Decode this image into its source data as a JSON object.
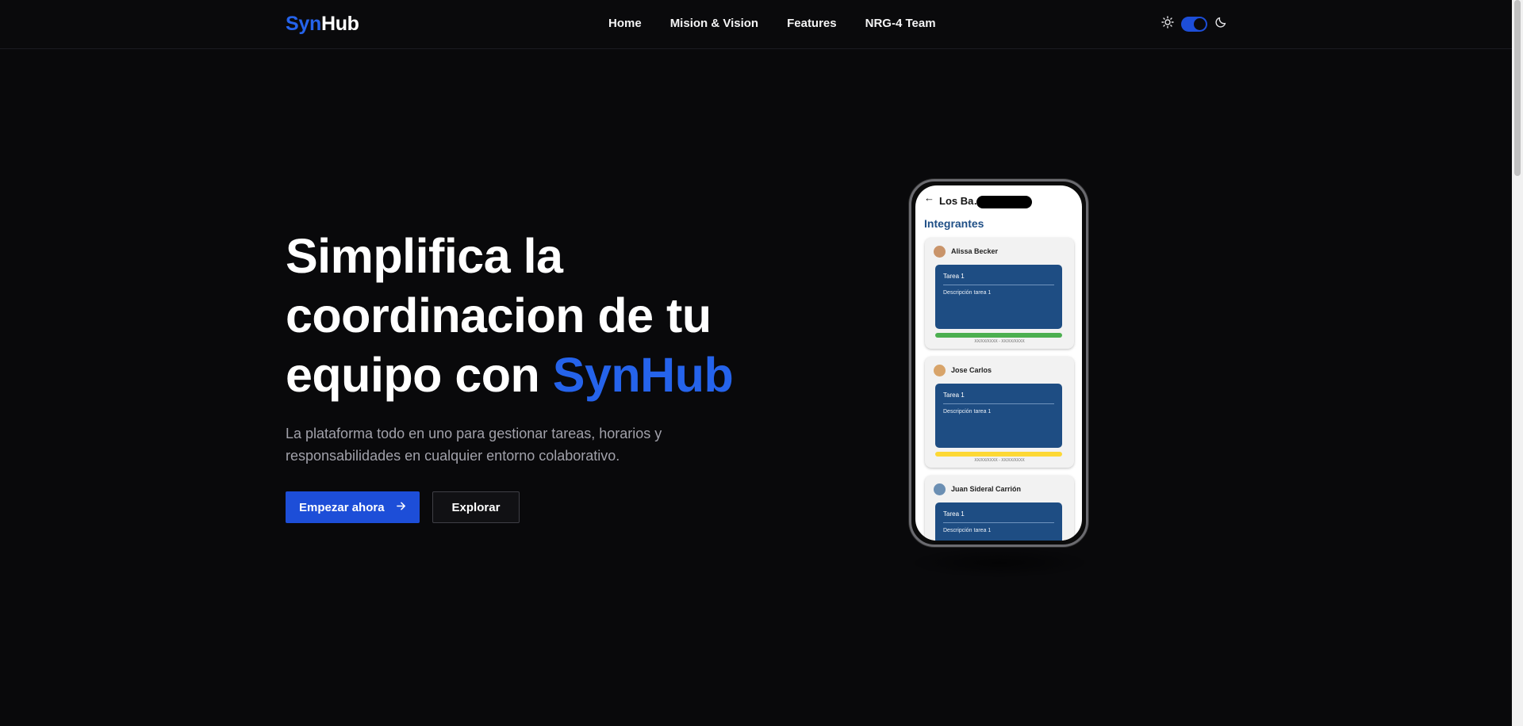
{
  "brand": {
    "part1": "Syn",
    "part2": "Hub"
  },
  "nav": {
    "items": [
      "Home",
      "Mision & Vision",
      "Features",
      "NRG-4 Team"
    ]
  },
  "theme": {
    "light_icon": "sun-icon",
    "dark_icon": "moon-icon",
    "toggle_state": "dark"
  },
  "hero": {
    "title_line1": "Simplifica la",
    "title_line2": "coordinacion de tu",
    "title_line3_prefix": "equipo con ",
    "title_accent": "SynHub",
    "subtitle": "La plataforma todo en uno para gestionar tareas, horarios y responsabilidades en cualquier entorno colaborativo.",
    "primary_button": "Empezar ahora",
    "primary_button_icon": "arrow-right-icon",
    "secondary_button": "Explorar"
  },
  "phone": {
    "app_title": "Los Ba… ns",
    "section_title": "Integrantes",
    "members": [
      {
        "name": "Alissa Becker",
        "task_title": "Tarea 1",
        "task_desc": "Descripción tarea 1",
        "dates": "XX/XX/XXXX - XX/XX/XXXX",
        "progress_color": "#4caf50"
      },
      {
        "name": "Jose Carlos",
        "task_title": "Tarea 1",
        "task_desc": "Descripción tarea 1",
        "dates": "XX/XX/XXXX - XX/XX/XXXX",
        "progress_color": "#fdd835"
      },
      {
        "name": "Juan Sideral Carrión",
        "task_title": "Tarea 1",
        "task_desc": "Descripción tarea 1",
        "dates": "",
        "progress_color": "#4caf50"
      }
    ]
  },
  "colors": {
    "accent": "#2563eb",
    "background": "#09090b",
    "button_primary": "#1d4ed8"
  }
}
